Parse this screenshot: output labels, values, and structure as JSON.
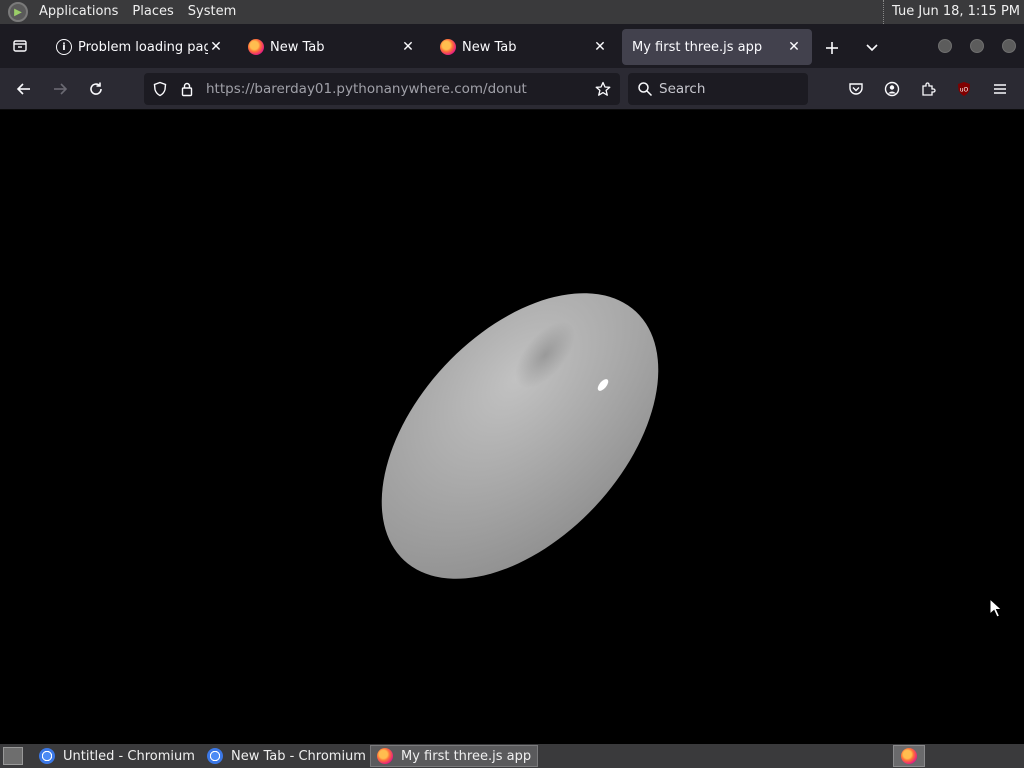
{
  "top_panel": {
    "menus": [
      "Applications",
      "Places",
      "System"
    ],
    "clock": "Tue Jun 18,  1:15 PM"
  },
  "tabs": [
    {
      "title": "Problem loading page",
      "icon": "info-icon",
      "active": false
    },
    {
      "title": "New Tab",
      "icon": "firefox-icon",
      "active": false
    },
    {
      "title": "New Tab",
      "icon": "firefox-icon",
      "active": false
    },
    {
      "title": "My first three.js app",
      "icon": "none",
      "active": true
    }
  ],
  "navbar": {
    "url_host": "https://barerday01.pythonanywhere.com",
    "url_path": "/donut",
    "search_placeholder": "Search"
  },
  "taskbar": {
    "tasks": [
      {
        "title": "Untitled - Chromium",
        "icon": "chromium-icon",
        "active": false
      },
      {
        "title": "New Tab - Chromium",
        "icon": "chromium-icon",
        "active": false
      },
      {
        "title": "My first three.js app ...",
        "icon": "firefox-icon",
        "active": true
      }
    ]
  },
  "colors": {
    "panel": "#3a3a3c",
    "tabbar": "#1c1b22",
    "navbar": "#2b2a33",
    "canvas": "#000000",
    "donut": "#a8a8a8"
  }
}
